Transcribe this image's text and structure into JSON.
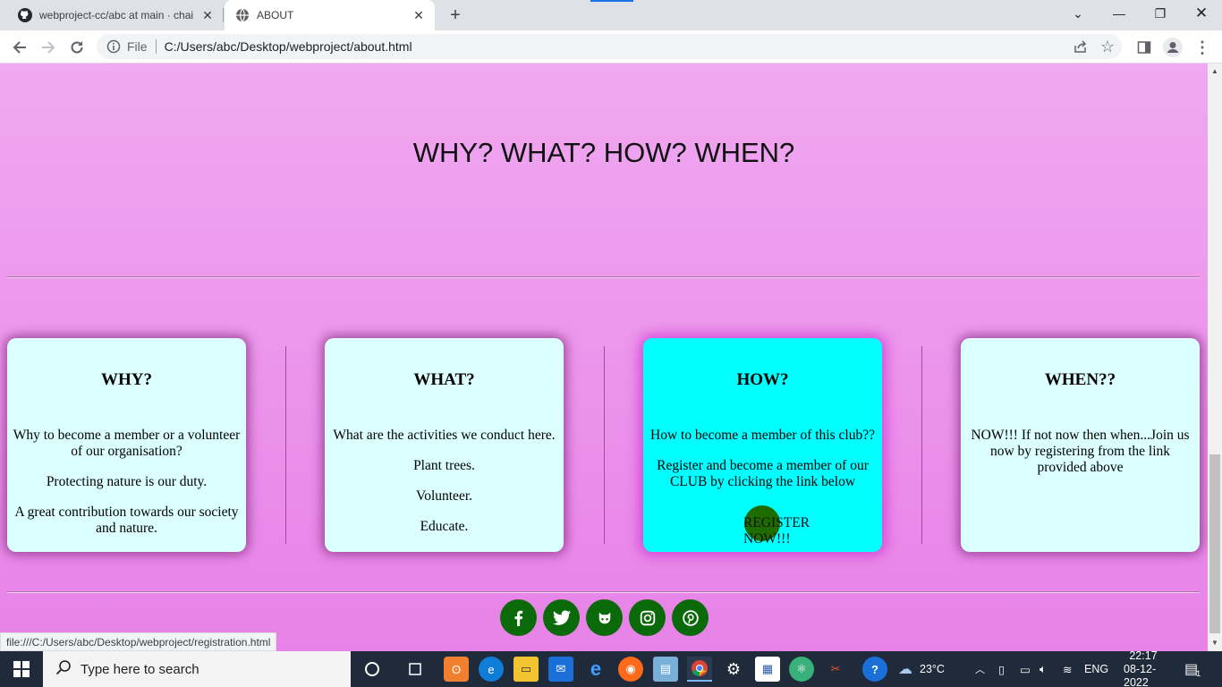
{
  "browser": {
    "tabs": [
      {
        "title": "webproject-cc/abc at main · chai"
      },
      {
        "title": "ABOUT"
      }
    ],
    "address_scheme": "File",
    "address_url": "C:/Users/abc/Desktop/webproject/about.html",
    "status_url": "file:///C:/Users/abc/Desktop/webproject/registration.html"
  },
  "page": {
    "heading": "WHY? WHAT? HOW? WHEN?",
    "cards": [
      {
        "title": "WHY?",
        "lines": [
          "Why to become a member or a volunteer of our organisation?",
          "Protecting nature is our duty.",
          "A great contribution towards our society and nature."
        ]
      },
      {
        "title": "WHAT?",
        "lines": [
          "What are the activities we conduct here.",
          "Plant trees.",
          "Volunteer.",
          "Educate."
        ]
      },
      {
        "title": "HOW?",
        "lines": [
          "How to become a member of this club??",
          "Register and become a member of our CLUB by clicking the link below"
        ],
        "link": "REGISTER NOW!!!"
      },
      {
        "title": "WHEN??",
        "lines": [
          "NOW!!! If not now then when...Join us now by registering from the link provided above"
        ]
      }
    ],
    "social_icons": [
      "facebook-icon",
      "twitter-icon",
      "github-icon",
      "instagram-icon",
      "pinterest-icon"
    ]
  },
  "taskbar": {
    "search_placeholder": "Type here to search",
    "weather": "23°C",
    "language": "ENG",
    "time": "22:17",
    "date": "08-12-2022",
    "notification_count": "1"
  }
}
